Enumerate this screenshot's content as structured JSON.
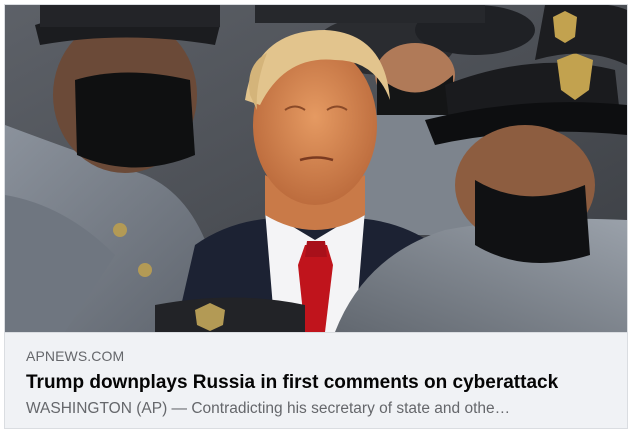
{
  "link_preview": {
    "domain": "APNEWS.COM",
    "headline": "Trump downplays Russia in first comments on cyberattack",
    "summary": "WASHINGTON (AP) — Contradicting his secretary of state and othe…",
    "image_subject": "Man in dark suit with red tie surrounded by cadets in grey uniforms and caps"
  },
  "colors": {
    "caption_background": "#f0f2f5",
    "domain_text": "#65676b",
    "headline_text": "#050505",
    "summary_text": "#65676b",
    "border": "#dadde1"
  }
}
